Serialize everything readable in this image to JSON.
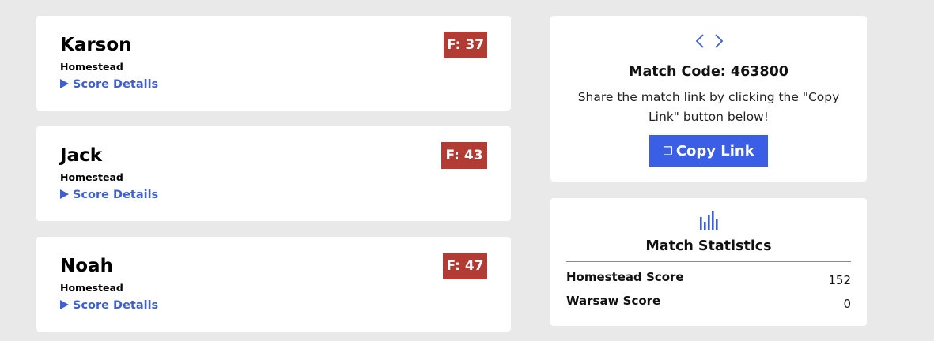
{
  "players": [
    {
      "name": "Karson",
      "team": "Homestead",
      "details_label": "Score Details",
      "badge": "F: 37"
    },
    {
      "name": "Jack",
      "team": "Homestead",
      "details_label": "Score Details",
      "badge": "F: 43"
    },
    {
      "name": "Noah",
      "team": "Homestead",
      "details_label": "Score Details",
      "badge": "F: 47"
    }
  ],
  "match": {
    "code_label": "Match Code: 463800",
    "share_text": "Share the match link by clicking the \"Copy Link\" button below!",
    "copy_icon": "❐",
    "copy_label": "Copy Link"
  },
  "stats": {
    "title": "Match Statistics",
    "rows": [
      {
        "label": "Homestead Score",
        "value": "152"
      },
      {
        "label": "Warsaw Score",
        "value": "0"
      }
    ]
  },
  "icons": {
    "code": "code-brackets-icon",
    "chart": "bar-chart-icon",
    "caret": "play-caret-icon",
    "copy": "copy-icon"
  },
  "colors": {
    "background": "#e9e9e9",
    "card": "#ffffff",
    "link_blue": "#3d5ed4",
    "button_blue": "#3a5ee6",
    "badge_red": "#b23c33"
  }
}
